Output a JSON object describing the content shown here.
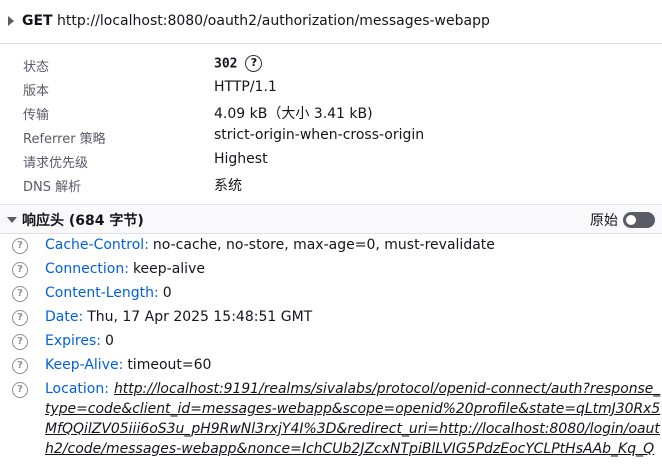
{
  "request": {
    "method": "GET",
    "url": "http://localhost:8080/oauth2/authorization/messages-webapp"
  },
  "summary": [
    {
      "key": "状态",
      "value": "302"
    },
    {
      "key": "版本",
      "value": "HTTP/1.1"
    },
    {
      "key": "传输",
      "value": "4.09 kB（大小 3.41 kB)"
    },
    {
      "key": "Referrer 策略",
      "value": "strict-origin-when-cross-origin"
    },
    {
      "key": "请求优先级",
      "value": "Highest"
    },
    {
      "key": "DNS 解析",
      "value": "系统"
    }
  ],
  "response_headers": {
    "title": "响应头 (684 字节)",
    "raw_label": "原始",
    "raw_toggle_on": true,
    "items": [
      {
        "name": "Cache-Control:",
        "value": "no-cache, no-store, max-age=0, must-revalidate"
      },
      {
        "name": "Connection:",
        "value": "keep-alive"
      },
      {
        "name": "Content-Length:",
        "value": "0"
      },
      {
        "name": "Date:",
        "value": "Thu, 17 Apr 2025 15:48:51 GMT"
      },
      {
        "name": "Expires:",
        "value": "0"
      },
      {
        "name": "Keep-Alive:",
        "value": "timeout=60"
      }
    ],
    "location": {
      "name": "Location:",
      "lines": [
        "http://localhost:9191/realms/sivalabs/protocol/openid-connect/auth?response_",
        "type=code&client_id=messages-webapp&scope=openid%20profile&state=qLtmJ30Rx5",
        "MfQQilZV05iii6oS3u_pH9RwNl3rxjY4I%3D&redirect_uri=http://localhost:8080/login/oaut",
        "h2/code/messages-webapp&nonce=IchCUb2JZcxNTpiBlLVIG5PdzEocYCLPtHsAAb_Kq_Q"
      ]
    }
  },
  "icons": {
    "help": "?",
    "header_info": "?"
  }
}
